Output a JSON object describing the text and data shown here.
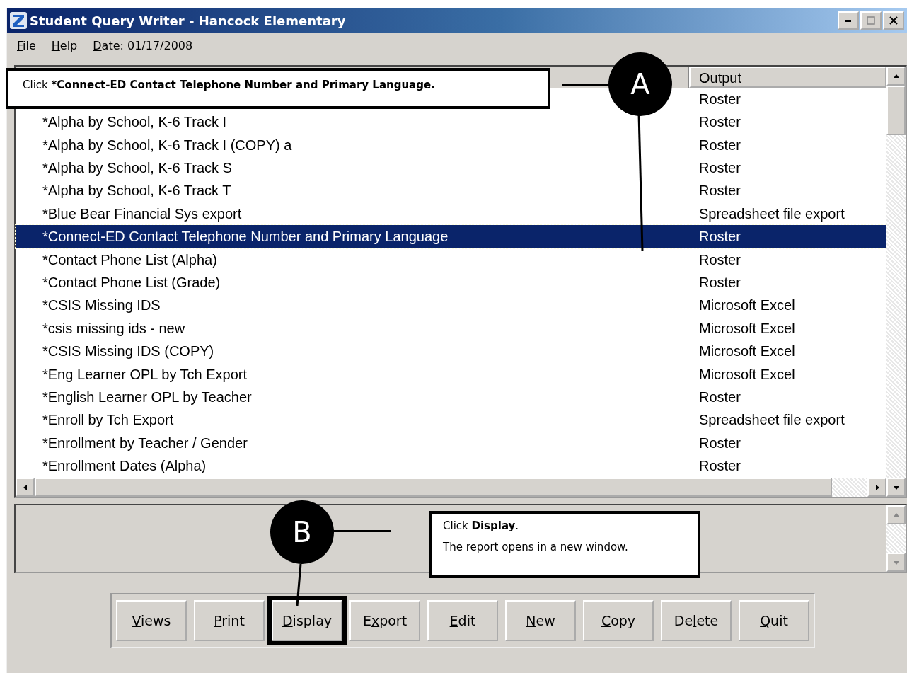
{
  "window": {
    "title": "Student Query Writer - Hancock Elementary"
  },
  "menu": [
    {
      "key": "F",
      "post": "ile"
    },
    {
      "key": "H",
      "post": "elp"
    },
    {
      "key": "D",
      "post": "ate: 01/17/2008"
    }
  ],
  "table": {
    "columns": [
      "Output"
    ],
    "rows": [
      {
        "output": "Roster",
        "selected": false
      },
      {
        "name": "*Alpha by School, K-6 Track I",
        "output": "Roster",
        "selected": false
      },
      {
        "name": "*Alpha by School, K-6 Track I (COPY) a",
        "output": "Roster",
        "selected": false
      },
      {
        "name": "*Alpha by School, K-6 Track S",
        "output": "Roster",
        "selected": false
      },
      {
        "name": "*Alpha by School, K-6 Track T",
        "output": "Roster",
        "selected": false
      },
      {
        "name": "*Blue Bear Financial Sys export",
        "output": "Spreadsheet file export",
        "selected": false
      },
      {
        "name": "*Connect-ED Contact Telephone Number and Primary Language",
        "output": "Roster",
        "selected": true
      },
      {
        "name": "*Contact Phone List (Alpha)",
        "output": "Roster",
        "selected": false
      },
      {
        "name": "*Contact Phone List (Grade)",
        "output": "Roster",
        "selected": false
      },
      {
        "name": "*CSIS Missing IDS",
        "output": "Microsoft Excel",
        "selected": false
      },
      {
        "name": "*csis missing ids - new",
        "output": "Microsoft Excel",
        "selected": false
      },
      {
        "name": "*CSIS Missing IDS (COPY)",
        "output": "Microsoft Excel",
        "selected": false
      },
      {
        "name": "*Eng Learner OPL by Tch Export",
        "output": "Microsoft Excel",
        "selected": false
      },
      {
        "name": "*English Learner OPL by Teacher",
        "output": "Roster",
        "selected": false
      },
      {
        "name": "*Enroll by Tch Export",
        "output": "Spreadsheet file export",
        "selected": false
      },
      {
        "name": "*Enrollment by Teacher / Gender",
        "output": "Roster",
        "selected": false
      },
      {
        "name": "*Enrollment Dates (Alpha)",
        "output": "Roster",
        "selected": false
      }
    ]
  },
  "buttons": [
    {
      "key": "V",
      "post": "iews",
      "highlighted": false
    },
    {
      "key": "P",
      "post": "rint",
      "highlighted": false
    },
    {
      "key": "D",
      "post": "isplay",
      "highlighted": true
    },
    {
      "pre": "E",
      "key": "x",
      "post": "port",
      "highlighted": false
    },
    {
      "key": "E",
      "post": "dit",
      "highlighted": false
    },
    {
      "key": "N",
      "post": "ew",
      "highlighted": false
    },
    {
      "key": "C",
      "post": "opy",
      "highlighted": false
    },
    {
      "pre": "De",
      "key": "l",
      "post": "ete",
      "highlighted": false
    },
    {
      "key": "Q",
      "post": "uit",
      "highlighted": false
    }
  ],
  "callouts": [
    {
      "marker": "A",
      "lines": [
        [
          {
            "text": "Click ",
            "bold": false
          },
          {
            "text": "*Connect-ED Contact Telephone Number and Primary Language.",
            "bold": true
          }
        ]
      ]
    },
    {
      "marker": "B",
      "lines": [
        [
          {
            "text": "Click ",
            "bold": false
          },
          {
            "text": "Display",
            "bold": true
          },
          {
            "text": ".",
            "bold": false
          }
        ],
        [
          {
            "text": "The report opens in a new window.",
            "bold": false
          }
        ]
      ]
    }
  ]
}
